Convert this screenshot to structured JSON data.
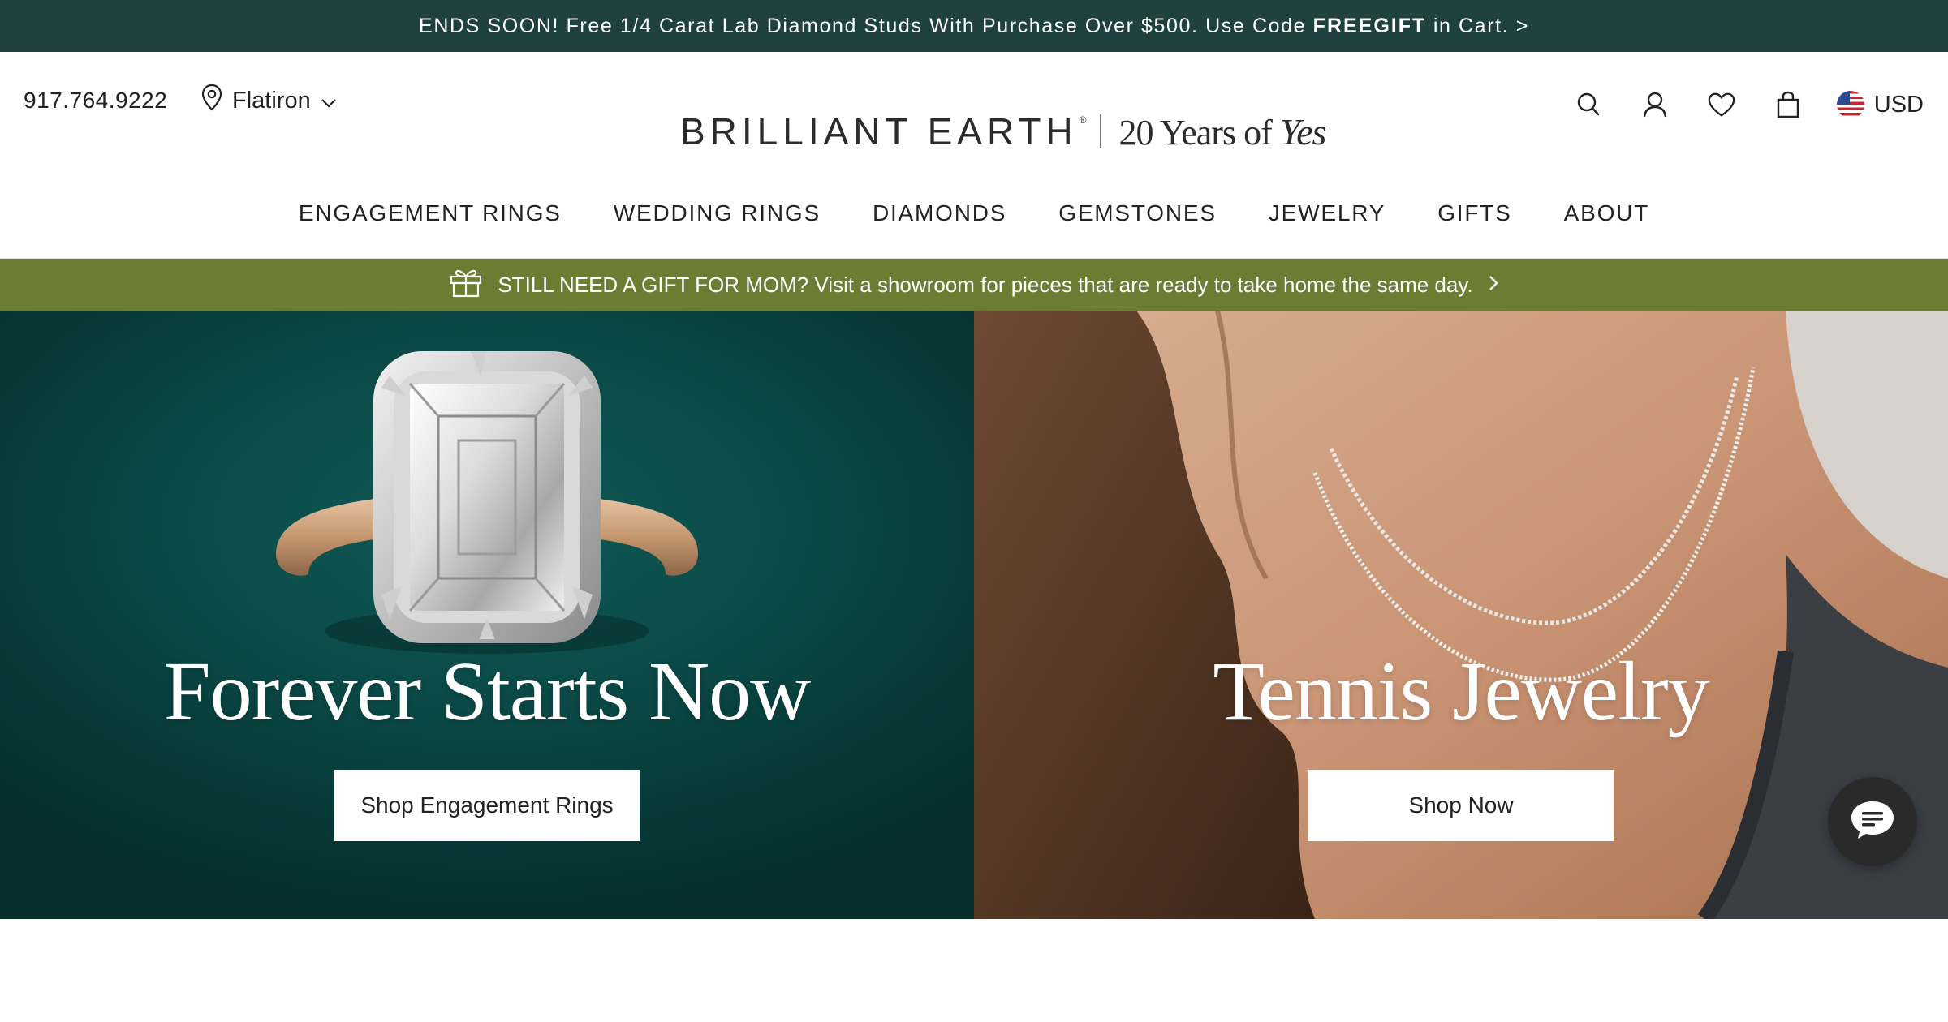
{
  "promo": {
    "text_before": "ENDS SOON! Free 1/4 Carat Lab Diamond Studs With Purchase Over $500. Use Code ",
    "code": "FREEGIFT",
    "text_after": " in Cart. >"
  },
  "header": {
    "phone": "917.764.9222",
    "store": "Flatiron",
    "logo_name": "BRILLIANT EARTH",
    "logo_reg": "®",
    "logo_tag_prefix": "20 Years of ",
    "logo_tag_script": "Yes",
    "currency": "USD",
    "icons": [
      "search-icon",
      "account-icon",
      "wishlist-heart-icon",
      "shopping-bag-icon",
      "us-flag-icon"
    ]
  },
  "nav": {
    "items": [
      "ENGAGEMENT RINGS",
      "WEDDING RINGS",
      "DIAMONDS",
      "GEMSTONES",
      "JEWELRY",
      "GIFTS",
      "ABOUT"
    ]
  },
  "gift_banner": {
    "text": "STILL NEED A GIFT FOR MOM? Visit a showroom for pieces that are ready to take home the same day."
  },
  "hero": {
    "left": {
      "title": "Forever Starts Now",
      "button": "Shop Engagement Rings"
    },
    "right": {
      "title": "Tennis Jewelry",
      "button": "Shop Now"
    }
  },
  "colors": {
    "promo_bg": "#1f4140",
    "gift_bg": "#6a7d33",
    "hero_left_bg": "#0b4a47",
    "chat_bg": "#2a2a2a"
  }
}
